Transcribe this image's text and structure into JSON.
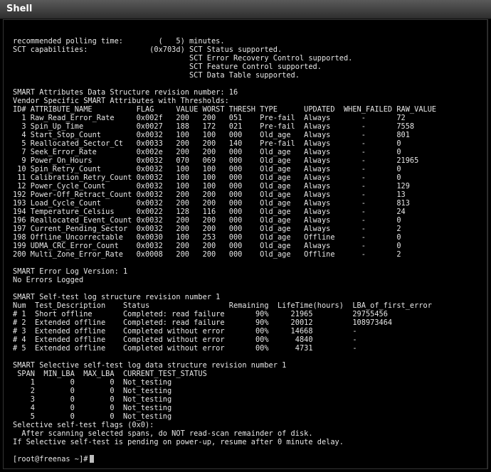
{
  "window": {
    "title": "Shell"
  },
  "terminal": {
    "lines": [
      "recommended polling time:        (   5) minutes.",
      "SCT capabilities:              (0x703d) SCT Status supported.",
      "                                        SCT Error Recovery Control supported.",
      "                                        SCT Feature Control supported.",
      "                                        SCT Data Table supported.",
      "",
      "SMART Attributes Data Structure revision number: 16",
      "Vendor Specific SMART Attributes with Thresholds:",
      "ID# ATTRIBUTE_NAME          FLAG     VALUE WORST THRESH TYPE      UPDATED  WHEN_FAILED RAW_VALUE",
      "  1 Raw_Read_Error_Rate     0x002f   200   200   051    Pre-fail  Always       -       72",
      "  3 Spin_Up_Time            0x0027   188   172   021    Pre-fail  Always       -       7558",
      "  4 Start_Stop_Count        0x0032   100   100   000    Old_age   Always       -       801",
      "  5 Reallocated_Sector_Ct   0x0033   200   200   140    Pre-fail  Always       -       0",
      "  7 Seek_Error_Rate         0x002e   200   200   000    Old_age   Always       -       0",
      "  9 Power_On_Hours          0x0032   070   069   000    Old_age   Always       -       21965",
      " 10 Spin_Retry_Count        0x0032   100   100   000    Old_age   Always       -       0",
      " 11 Calibration_Retry_Count 0x0032   100   100   000    Old_age   Always       -       0",
      " 12 Power_Cycle_Count       0x0032   100   100   000    Old_age   Always       -       129",
      "192 Power-Off_Retract_Count 0x0032   200   200   000    Old_age   Always       -       13",
      "193 Load_Cycle_Count        0x0032   200   200   000    Old_age   Always       -       813",
      "194 Temperature_Celsius     0x0022   128   116   000    Old_age   Always       -       24",
      "196 Reallocated_Event_Count 0x0032   200   200   000    Old_age   Always       -       0",
      "197 Current_Pending_Sector  0x0032   200   200   000    Old_age   Always       -       2",
      "198 Offline_Uncorrectable   0x0030   100   253   000    Old_age   Offline      -       0",
      "199 UDMA_CRC_Error_Count    0x0032   200   200   000    Old_age   Always       -       0",
      "200 Multi_Zone_Error_Rate   0x0008   200   200   000    Old_age   Offline      -       2",
      "",
      "SMART Error Log Version: 1",
      "No Errors Logged",
      "",
      "SMART Self-test log structure revision number 1",
      "Num  Test_Description    Status                  Remaining  LifeTime(hours)  LBA_of_first_error",
      "# 1  Short offline       Completed: read failure       90%     21965         29755456",
      "# 2  Extended offline    Completed: read failure       90%     20012         108973464",
      "# 3  Extended offline    Completed without error       00%     14668         -",
      "# 4  Extended offline    Completed without error       00%      4840         -",
      "# 5  Extended offline    Completed without error       00%      4731         -",
      "",
      "SMART Selective self-test log data structure revision number 1",
      " SPAN  MIN_LBA  MAX_LBA  CURRENT_TEST_STATUS",
      "    1        0        0  Not_testing",
      "    2        0        0  Not_testing",
      "    3        0        0  Not_testing",
      "    4        0        0  Not_testing",
      "    5        0        0  Not_testing",
      "Selective self-test flags (0x0):",
      "  After scanning selected spans, do NOT read-scan remainder of disk.",
      "If Selective self-test is pending on power-up, resume after 0 minute delay."
    ],
    "prompt": "[root@freenas ~]#"
  }
}
